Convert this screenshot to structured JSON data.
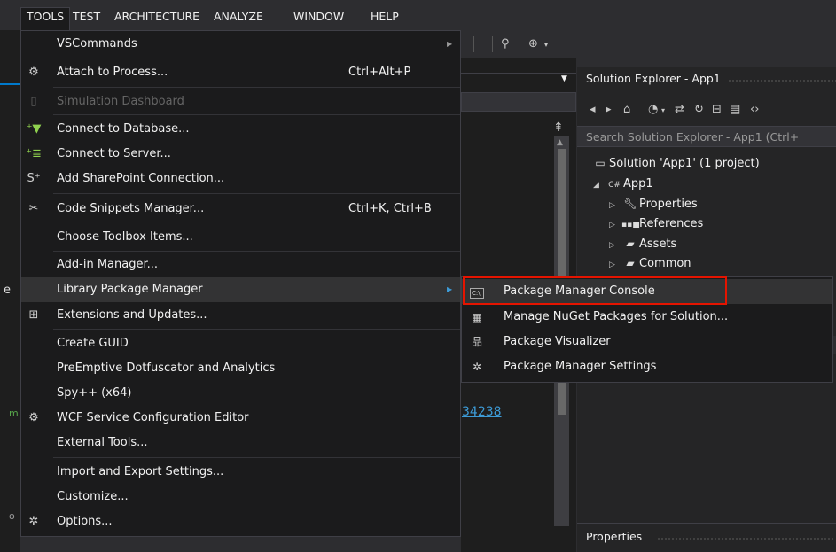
{
  "menubar": {
    "items": [
      "TOOLS",
      "TEST",
      "ARCHITECTURE",
      "ANALYZE",
      "WINDOW",
      "HELP"
    ]
  },
  "tools_menu": {
    "items": [
      {
        "label": "VSCommands",
        "shortcut": "",
        "icon": "none",
        "submenu": true,
        "disabled": false
      },
      {
        "label": "Attach to Process...",
        "shortcut": "Ctrl+Alt+P",
        "icon": "attach-process-icon",
        "submenu": false,
        "disabled": false
      },
      {
        "label": "Simulation Dashboard",
        "shortcut": "",
        "icon": "simulation-dashboard-icon",
        "submenu": false,
        "disabled": true
      },
      {
        "label": "Connect to Database...",
        "shortcut": "",
        "icon": "connect-database-icon",
        "submenu": false,
        "disabled": false
      },
      {
        "label": "Connect to Server...",
        "shortcut": "",
        "icon": "connect-server-icon",
        "submenu": false,
        "disabled": false
      },
      {
        "label": "Add SharePoint Connection...",
        "shortcut": "",
        "icon": "sharepoint-icon",
        "submenu": false,
        "disabled": false
      },
      {
        "label": "Code Snippets Manager...",
        "shortcut": "Ctrl+K, Ctrl+B",
        "icon": "code-snippets-icon",
        "submenu": false,
        "disabled": false
      },
      {
        "label": "Choose Toolbox Items...",
        "shortcut": "",
        "icon": "none",
        "submenu": false,
        "disabled": false
      },
      {
        "label": "Add-in Manager...",
        "shortcut": "",
        "icon": "none",
        "submenu": false,
        "disabled": false
      },
      {
        "label": "Library Package Manager",
        "shortcut": "",
        "icon": "none",
        "submenu": true,
        "disabled": false
      },
      {
        "label": "Extensions and Updates...",
        "shortcut": "",
        "icon": "extensions-icon",
        "submenu": false,
        "disabled": false
      },
      {
        "label": "Create GUID",
        "shortcut": "",
        "icon": "none",
        "submenu": false,
        "disabled": false
      },
      {
        "label": "PreEmptive Dotfuscator and Analytics",
        "shortcut": "",
        "icon": "none",
        "submenu": false,
        "disabled": false
      },
      {
        "label": "Spy++ (x64)",
        "shortcut": "",
        "icon": "none",
        "submenu": false,
        "disabled": false
      },
      {
        "label": "WCF Service Configuration Editor",
        "shortcut": "",
        "icon": "wcf-editor-icon",
        "submenu": false,
        "disabled": false
      },
      {
        "label": "External Tools...",
        "shortcut": "",
        "icon": "none",
        "submenu": false,
        "disabled": false
      },
      {
        "label": "Import and Export Settings...",
        "shortcut": "",
        "icon": "none",
        "submenu": false,
        "disabled": false
      },
      {
        "label": "Customize...",
        "shortcut": "",
        "icon": "none",
        "submenu": false,
        "disabled": false
      },
      {
        "label": "Options...",
        "shortcut": "",
        "icon": "gear-icon",
        "submenu": false,
        "disabled": false
      }
    ]
  },
  "submenu": {
    "items": [
      {
        "label": "Package Manager Console",
        "icon": "console-icon"
      },
      {
        "label": "Manage NuGet Packages for Solution...",
        "icon": "nuget-icon"
      },
      {
        "label": "Package Visualizer",
        "icon": "visualizer-icon"
      },
      {
        "label": "Package Manager Settings",
        "icon": "gear-icon"
      }
    ]
  },
  "solution_explorer": {
    "title": "Solution Explorer - App1",
    "search_placeholder": "Search Solution Explorer - App1 (Ctrl+",
    "solution_label": "Solution 'App1' (1 project)",
    "project_label": "App1",
    "folders": [
      "Properties",
      "References",
      "Assets",
      "Common"
    ]
  },
  "properties_panel": {
    "title": "Properties"
  },
  "editor": {
    "link_fragment": "34238"
  },
  "fragments": {
    "left_e": "e",
    "left_m": "m",
    "left_o": "o"
  },
  "colors": {
    "highlight_box": "#e51400",
    "accent": "#007acc",
    "link": "#3d9bd7"
  }
}
